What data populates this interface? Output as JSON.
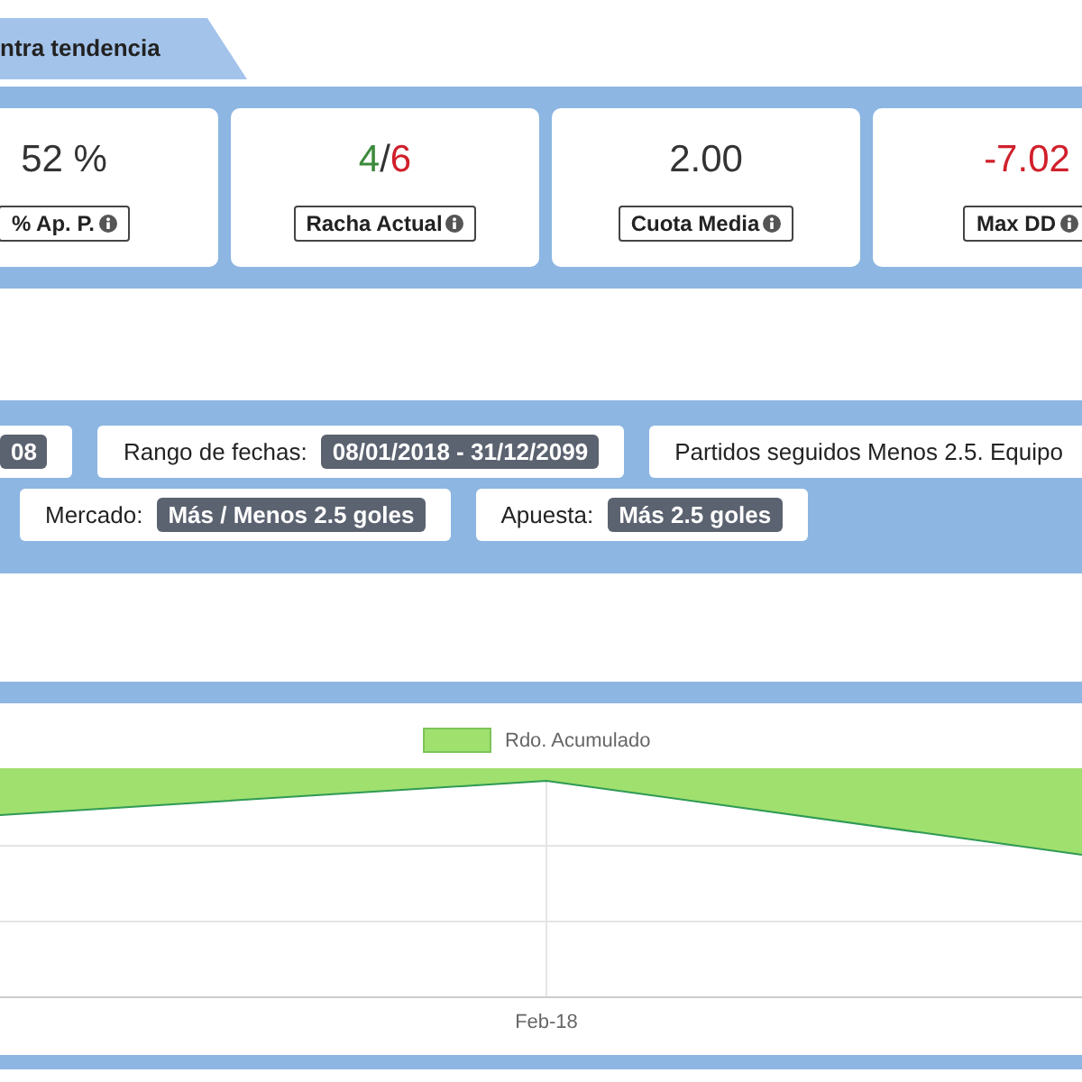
{
  "tab": {
    "label": "ntra tendencia"
  },
  "stats": [
    {
      "parts": [
        {
          "text": "52 %",
          "color": "#333333"
        }
      ],
      "label": "% Ap. P."
    },
    {
      "parts": [
        {
          "text": "4",
          "color": "#3c8a3c"
        },
        {
          "text": "/",
          "color": "#333333"
        },
        {
          "text": "6",
          "color": "#d0202b"
        }
      ],
      "label": "Racha Actual"
    },
    {
      "parts": [
        {
          "text": "2.00",
          "color": "#333333"
        }
      ],
      "label": "Cuota Media"
    },
    {
      "parts": [
        {
          "text": "-7.02",
          "color": "#d0202b"
        }
      ],
      "label": "Max DD"
    }
  ],
  "filters": [
    [
      {
        "value": "08"
      },
      {
        "label": "Rango de fechas:",
        "value": "08/01/2018 - 31/12/2099"
      },
      {
        "label": "Partidos seguidos Menos 2.5. Equipo"
      }
    ],
    [
      {
        "label": "Mercado:",
        "value": "Más / Menos 2.5 goles"
      },
      {
        "label": "Apuesta:",
        "value": "Más 2.5 goles"
      }
    ]
  ],
  "chart": {
    "legend": "Rdo. Acumulado",
    "x_label": "Feb-18"
  }
}
